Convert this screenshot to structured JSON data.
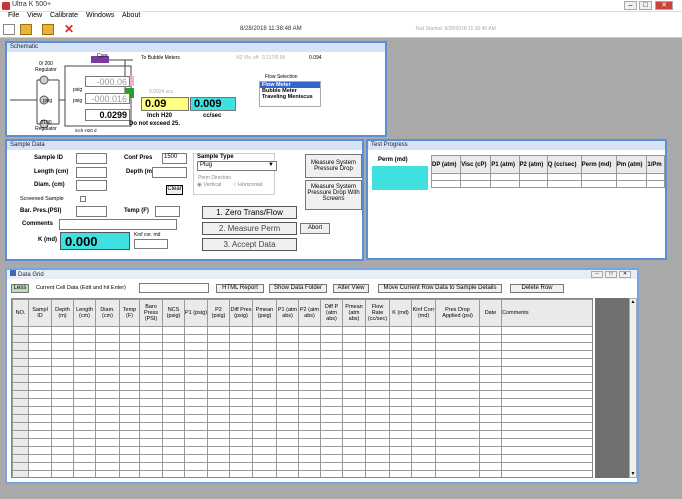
{
  "app": {
    "title": "Ultra K 500+"
  },
  "window_controls": {
    "minimize": "–",
    "maximize": "□",
    "close": "✕"
  },
  "menu": [
    "File",
    "View",
    "Calibrate",
    "Windows",
    "About"
  ],
  "toolbar": {
    "datetime": "8/28/2018 11:38:48 AM",
    "faint_status": "Test Started: 8/28/2018 11:36:45 AM"
  },
  "schematic": {
    "title": "Schematic",
    "core_label": "Core",
    "bubble_label": "To Bubble Meters",
    "n2_label": "N2 Vlv. off",
    "n2_value": "0.117/0.06",
    "n2_value2": "0.094",
    "regulator_label_top": "0/ 200 Regulator",
    "regulator_label_bot": "2100 Regulator",
    "psig_label": "psig",
    "psig_top": "psig",
    "psig_mid": "psig",
    "inch_h2o_label": "inch H20 d",
    "gauge1": "-000.06",
    "gauge2": "-000.016",
    "gauge3": "0.0299",
    "flow_faint": "0.0024 scc",
    "dp_value": "0.09",
    "flow_value": "0.009",
    "dp_unit": "Inch H20",
    "flow_unit": "cc/sec",
    "warning": "Do not exceed 25.",
    "flow_selection_title": "Flow Selection",
    "flow_options": [
      "Flow Meter",
      "Bubble Meter",
      "Traveling Meniscus"
    ],
    "flow_selected_index": 0
  },
  "sample": {
    "title": "Sample Data",
    "sample_id_label": "Sample ID",
    "length_label": "Length (cm)",
    "diam_label": "Diam. (cm)",
    "screened_label": "Screened Sample",
    "bar_press_label": "Bar. Pres.(PSI)",
    "comments_label": "Comments",
    "k_label": "K (md)",
    "k_value": "0.000",
    "conf_pres_label": "Conf Pres",
    "conf_pres_value": "1500",
    "depth_label": "Depth (m)",
    "temp_label": "Temp (F)",
    "clear_label": "Clear",
    "sample_type_label": "Sample Type",
    "sample_type_value": "Plug",
    "perm_dir_label": "Perm Direction",
    "vertical_label": "Vertical",
    "horizontal_label": "Horizontal",
    "measure_sys_drop": "Measure System Pressure Drop",
    "measure_sys_drop_screen": "Measure System Pressure Drop With Screens",
    "kinf_label": "Kinf cor. md",
    "btn_zero": "1. Zero Trans/Flow",
    "btn_measure": "2. Measure Perm",
    "btn_abort": "Abort",
    "btn_accept": "3. Accept Data"
  },
  "progress": {
    "title": "Test Progress",
    "perm_label": "Perm (md)",
    "columns": [
      "DP (atm)",
      "Visc (cP)",
      "P1 (atm)",
      "P2 (atm)",
      "Q (cc/sec)",
      "Perm (md)",
      "Pm (atm)",
      "1/Pm"
    ]
  },
  "datagrid": {
    "title": "Data Grid",
    "less_btn": "Less",
    "current_cell_label": "Current Cell Data (Edit and hit Enter)",
    "btn_html": "HTML Report",
    "btn_folder": "Show Data Folder",
    "btn_alter": "Alter View",
    "btn_move": "Move Current Row Data to Sample Details",
    "btn_delete": "Delete Row",
    "columns": [
      "NO.",
      "Sampl ID",
      "Depth (m)",
      "Length (cm)",
      "Diam. (cm)",
      "Temp (F)",
      "Baro Press (PSI)",
      "NCS (psig)",
      "P1 (psig)",
      "P2 (psig)",
      "Diff Pres (psig)",
      "Pmean (psig)",
      "P1 (atm abs)",
      "P2 (atm abs)",
      "Diff P (atm abs)",
      "Pmean (atm abs)",
      "Flow Rate (cc/sec)",
      "K (md)",
      "Kinf Corr (md)",
      "Pres Drop Applied (psi)",
      "Date",
      "Comments"
    ]
  }
}
